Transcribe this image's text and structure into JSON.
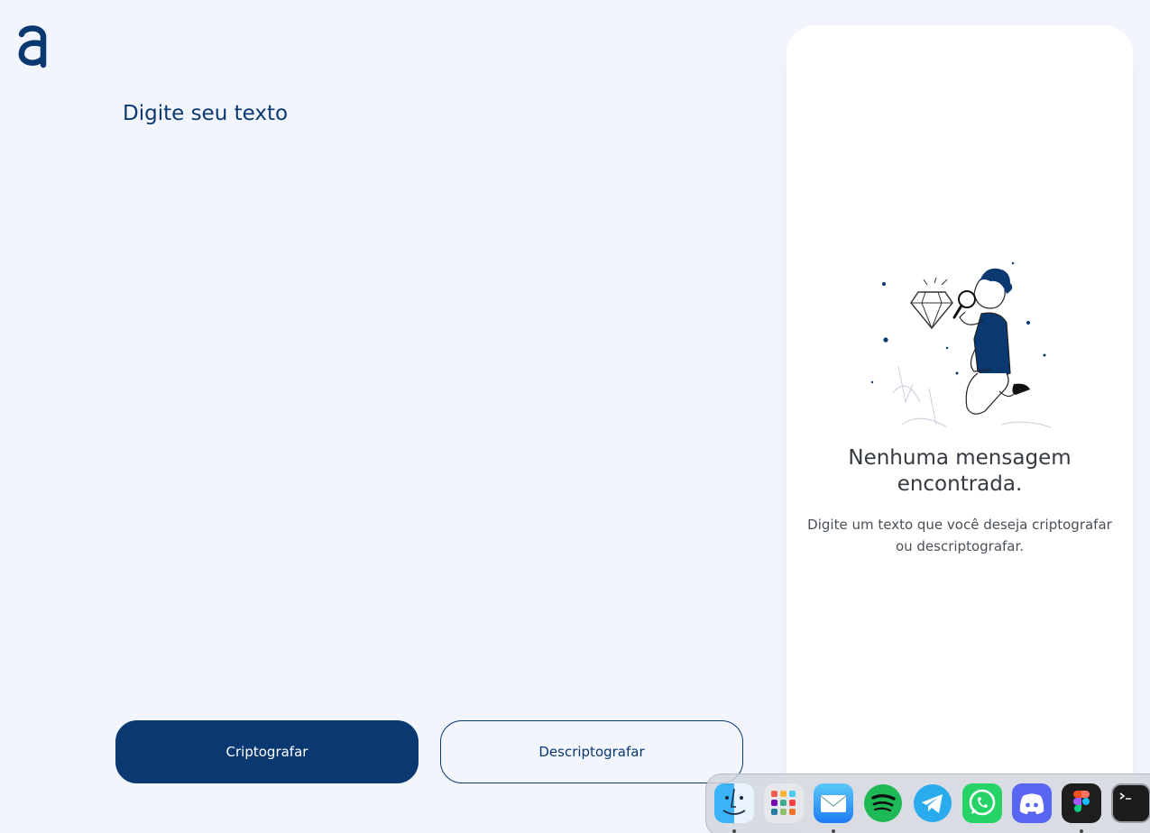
{
  "logo": {
    "icon": "alura-a-logo"
  },
  "input": {
    "placeholder": "Digite seu texto",
    "value": ""
  },
  "buttons": {
    "encrypt_label": "Criptografar",
    "decrypt_label": "Descriptografar"
  },
  "output_panel": {
    "illustration": "person-with-magnifying-glass-illustration",
    "title": "Nenhuma mensagem encontrada.",
    "description": "Digite um texto que você deseja criptografar ou descriptografar."
  },
  "dock": {
    "apps": [
      {
        "icon": "finder-icon",
        "running": true
      },
      {
        "icon": "launchpad-icon",
        "running": false
      },
      {
        "icon": "mail-icon",
        "running": true
      },
      {
        "icon": "spotify-icon",
        "running": false
      },
      {
        "icon": "telegram-icon",
        "running": false
      },
      {
        "icon": "whatsapp-icon",
        "running": false
      },
      {
        "icon": "discord-icon",
        "running": false
      },
      {
        "icon": "figma-icon",
        "running": true
      },
      {
        "icon": "terminal-icon",
        "running": false
      }
    ]
  },
  "colors": {
    "background": "#F2F5FC",
    "primary": "#0A3871",
    "panel": "#FFFFFF",
    "title_text": "#343A40",
    "body_text": "#495057"
  }
}
